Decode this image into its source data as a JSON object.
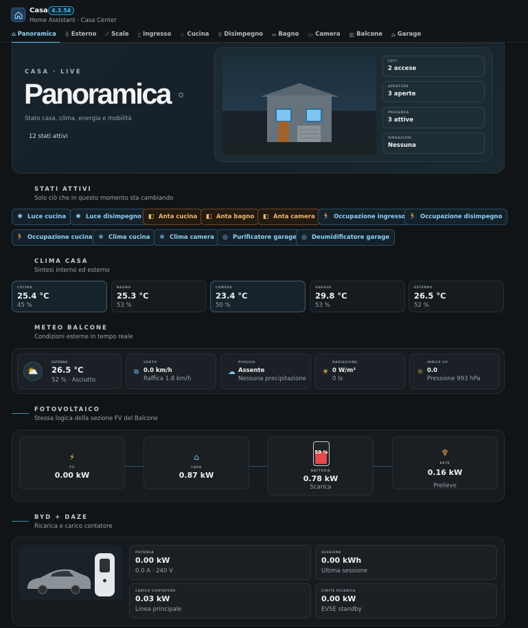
{
  "app": {
    "title": "Casa",
    "version": "4.3.54",
    "subtitle": "Home Assistant · Casa Center"
  },
  "tabs": [
    {
      "label": "Panoramica",
      "icon": "home-icon",
      "active": true
    },
    {
      "label": "Esterno",
      "icon": "bulb-icon"
    },
    {
      "label": "Scale",
      "icon": "stairs-icon"
    },
    {
      "label": "Ingresso",
      "icon": "door-icon"
    },
    {
      "label": "Cucina",
      "icon": "pot-icon"
    },
    {
      "label": "Disimpegno",
      "icon": "walk-icon"
    },
    {
      "label": "Bagno",
      "icon": "bath-icon"
    },
    {
      "label": "Camera",
      "icon": "bed-icon"
    },
    {
      "label": "Balcone",
      "icon": "balcony-icon"
    },
    {
      "label": "Garage",
      "icon": "garage-icon"
    }
  ],
  "hero": {
    "kicker": "CASA · LIVE",
    "title": "Panoramica",
    "description": "Stato casa, clima, energia e mobilità",
    "count": "12 stati attivi",
    "stats": [
      {
        "label": "LUCI",
        "value": "2 accese"
      },
      {
        "label": "APERTURE",
        "value": "3 aperte"
      },
      {
        "label": "PRESENZA",
        "value": "3 attive"
      },
      {
        "label": "VIBRAZIONI",
        "value": "Nessuna"
      }
    ]
  },
  "stati": {
    "title": "STATI ATTIVI",
    "subtitle": "Solo ciò che in questo momento sta cambiando",
    "chips": [
      {
        "label": "Luce cucina",
        "icon": "bulb-icon",
        "glyph": "✺",
        "warm": false
      },
      {
        "label": "Luce disimpegno",
        "icon": "bulb-icon",
        "glyph": "✺",
        "warm": false
      },
      {
        "label": "Anta cucina",
        "icon": "door-open-icon",
        "glyph": "◧",
        "warm": true
      },
      {
        "label": "Anta bagno",
        "icon": "door-open-icon",
        "glyph": "◧",
        "warm": true
      },
      {
        "label": "Anta camera",
        "icon": "door-open-icon",
        "glyph": "◧",
        "warm": true
      },
      {
        "label": "Occupazione ingresso",
        "icon": "motion-icon",
        "glyph": "🏃",
        "warm": false
      },
      {
        "label": "Occupazione disimpegno",
        "icon": "motion-icon",
        "glyph": "🏃",
        "warm": false
      },
      {
        "label": "Occupazione cucina",
        "icon": "motion-icon",
        "glyph": "🏃",
        "warm": false
      },
      {
        "label": "Clima cucina",
        "icon": "ac-icon",
        "glyph": "❄",
        "warm": false
      },
      {
        "label": "Clima camera",
        "icon": "ac-icon",
        "glyph": "❄",
        "warm": false
      },
      {
        "label": "Purificatore garage",
        "icon": "purifier-icon",
        "glyph": "◎",
        "warm": false
      },
      {
        "label": "Deumidificatore garage",
        "icon": "dehumidifier-icon",
        "glyph": "◎",
        "warm": false
      }
    ]
  },
  "clima": {
    "title": "CLIMA CASA",
    "subtitle": "Sintesi interno ed esterno",
    "rooms": [
      {
        "label": "CUCINA",
        "temp": "25.4 °C",
        "hum": "45 %",
        "highlight": true
      },
      {
        "label": "BAGNO",
        "temp": "25.3 °C",
        "hum": "53 %",
        "highlight": false
      },
      {
        "label": "CAMERA",
        "temp": "23.4 °C",
        "hum": "50 %",
        "highlight": true
      },
      {
        "label": "GARAGE",
        "temp": "29.8 °C",
        "hum": "53 %",
        "highlight": false
      },
      {
        "label": "ESTERNO",
        "temp": "26.5 °C",
        "hum": "52 %",
        "highlight": false
      }
    ]
  },
  "meteo": {
    "title": "METEO BALCONE",
    "subtitle": "Condizioni esterne in tempo reale",
    "main": {
      "label": "ESTERNO",
      "value": "26.5 °C",
      "sub": "52 % · Asciutto"
    },
    "cards": [
      {
        "label": "VENTO",
        "value": "0.0 km/h",
        "sub": "Raffica 1.8 km/h",
        "icon": "wind-icon",
        "glyph": "≋"
      },
      {
        "label": "PIOGGIA",
        "value": "Assente",
        "sub": "Nessuna precipitazione",
        "icon": "rain-icon",
        "glyph": "☁"
      },
      {
        "label": "RADIAZIONE",
        "value": "0 W/m²",
        "sub": "0 lx",
        "icon": "sun-icon",
        "glyph": "☀"
      },
      {
        "label": "INDICE UV",
        "value": "0.0",
        "sub": "Pressione 993 hPa",
        "icon": "uv-icon",
        "glyph": "☼"
      }
    ]
  },
  "fv": {
    "title": "FOTOVOLTAICO",
    "subtitle": "Stessa logica della sezione FV del Balcone",
    "pv": {
      "label": "FV",
      "value": "0.00 kW"
    },
    "casa": {
      "label": "CASA",
      "value": "0.87 kW"
    },
    "batteria": {
      "label": "BATTERIA",
      "value": "0.78 kW",
      "sub": "Scarica",
      "percent": "59 %"
    },
    "rete": {
      "label": "RETE",
      "value": "0.16 kW",
      "sub": "Prelievo"
    }
  },
  "ev": {
    "title": "BYD + DAZE",
    "subtitle": "Ricarica e carico contatore",
    "cards": [
      {
        "label": "POTENZA",
        "value": "0.00 kW",
        "sub": "0.0 A · 240 V"
      },
      {
        "label": "SESSIONE",
        "value": "0.00 kWh",
        "sub": "Ultima sessione"
      },
      {
        "label": "CARICO CONTATORE",
        "value": "0.03 kW",
        "sub": "Linea principale"
      },
      {
        "label": "LIMITE RICARICA",
        "value": "0.00 kW",
        "sub": "EVSE standby"
      }
    ]
  },
  "colors": {
    "accent": "#57c0ee",
    "warm": "#f1b76a",
    "battery": "#e5484d"
  }
}
